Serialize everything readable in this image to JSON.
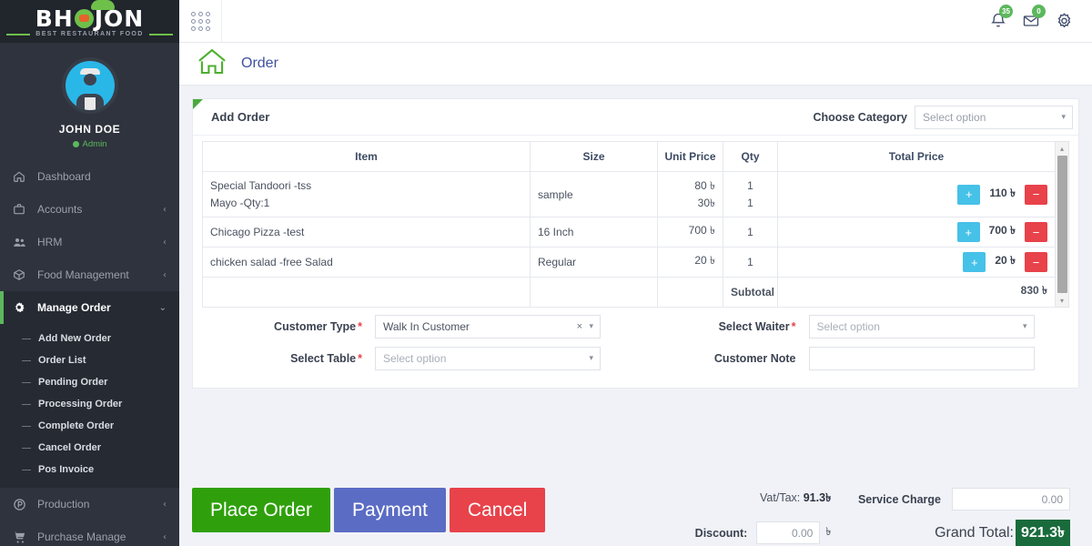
{
  "brand": {
    "name_part1": "BH",
    "name_part2": "JON",
    "tagline": "BEST RESTAURANT FOOD"
  },
  "profile": {
    "name": "JOHN DOE",
    "role": "Admin"
  },
  "sidebar": {
    "items": [
      {
        "label": "Dashboard",
        "icon": "home-icon",
        "arrow": "",
        "active": false
      },
      {
        "label": "Accounts",
        "icon": "briefcase-icon",
        "arrow": "‹",
        "active": false
      },
      {
        "label": "HRM",
        "icon": "users-icon",
        "arrow": "‹",
        "active": false
      },
      {
        "label": "Food Management",
        "icon": "box-icon",
        "arrow": "‹",
        "active": false
      },
      {
        "label": "Manage Order",
        "icon": "gear-icon",
        "arrow": "⌄",
        "active": true
      },
      {
        "label": "Production",
        "icon": "production-icon",
        "arrow": "‹",
        "active": false
      },
      {
        "label": "Purchase Manage",
        "icon": "cart-icon",
        "arrow": "‹",
        "active": false
      }
    ],
    "submenu": [
      "Add New Order",
      "Order List",
      "Pending Order",
      "Processing Order",
      "Complete Order",
      "Cancel Order",
      "Pos Invoice"
    ]
  },
  "topbar": {
    "grid_icon": "apps-grid-icon",
    "notification_badge": "35",
    "mail_badge": "0"
  },
  "pagehead": {
    "title": "Order",
    "icon": "home-icon"
  },
  "panel": {
    "title": "Add Order",
    "category_label": "Choose Category",
    "category_value": "Select option"
  },
  "table": {
    "headers": [
      "Item",
      "Size",
      "Unit Price",
      "Qty",
      "Total Price"
    ],
    "rows": [
      {
        "item_lines": [
          "Special Tandoori -tss",
          "Mayo -Qty:1"
        ],
        "size": "sample",
        "unit_lines": [
          "80 ৳",
          "30৳"
        ],
        "qty_lines": [
          "1",
          "1"
        ],
        "total": "110 ৳",
        "plus": "+",
        "minus": "−"
      },
      {
        "item_lines": [
          "Chicago Pizza -test"
        ],
        "size": "16 Inch",
        "unit_lines": [
          "700 ৳"
        ],
        "qty_lines": [
          "1"
        ],
        "total": "700 ৳",
        "plus": "+",
        "minus": "−"
      },
      {
        "item_lines": [
          "chicken salad -free Salad"
        ],
        "size": "Regular",
        "unit_lines": [
          "20 ৳"
        ],
        "qty_lines": [
          "1"
        ],
        "total": "20 ৳",
        "plus": "+",
        "minus": "−"
      }
    ],
    "subtotal_label": "Subtotal",
    "subtotal_value": "830 ৳"
  },
  "form": {
    "customer_type_label": "Customer Type",
    "customer_type_value": "Walk In Customer",
    "select_table_label": "Select Table",
    "select_table_value": "Select option",
    "select_waiter_label": "Select Waiter",
    "select_waiter_value": "Select option",
    "customer_note_label": "Customer Note",
    "customer_note_value": "",
    "required_mark": "*",
    "clear_mark": "×",
    "caret": "▾"
  },
  "actions": {
    "place_order": "Place Order",
    "payment": "Payment",
    "cancel": "Cancel"
  },
  "totals": {
    "vat_label": "Vat/Tax:",
    "vat_value": "91.3৳",
    "discount_label": "Discount:",
    "discount_value": "0.00",
    "discount_currency": "৳",
    "service_charge_label": "Service Charge",
    "service_charge_value": "0.00",
    "grand_total_label": "Grand Total:",
    "grand_total_value": "921.3৳"
  },
  "colors": {
    "sidebar_bg": "#2e333d",
    "brand_bg": "#21252c",
    "accent_green": "#5cb85c",
    "place_order": "#2fa00c",
    "payment": "#5b6cc4",
    "cancel": "#e8424a",
    "plus_button": "#46c1e8",
    "grand_total_bg": "#1a6b3c",
    "page_title": "#3f51a0"
  },
  "scrollbar": {
    "up": "▴",
    "down": "▾"
  }
}
